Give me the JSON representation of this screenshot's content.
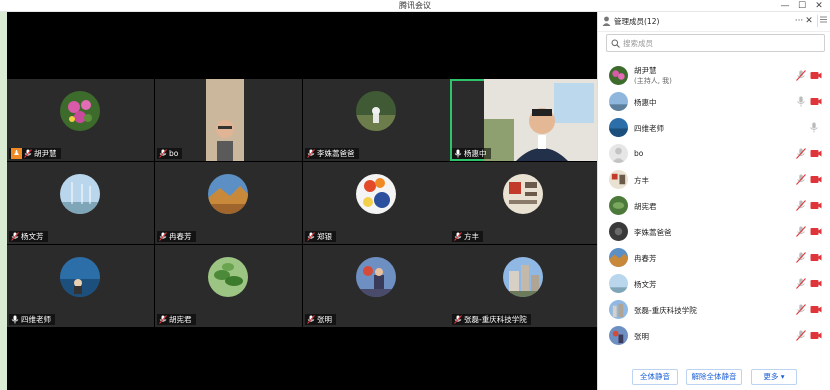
{
  "window": {
    "title": "腾讯会议",
    "minimize": "—",
    "maximize": "☐",
    "close": "✕"
  },
  "grid": {
    "tiles": [
      {
        "name": "胡尹慧",
        "host": true,
        "mic": "muted"
      },
      {
        "name": "bo",
        "mic": "muted"
      },
      {
        "name": "李姝蒿爸爸",
        "mic": "muted"
      },
      {
        "name": "杨惠中",
        "mic": "on",
        "active": true
      },
      {
        "name": "杨文芳",
        "mic": "muted"
      },
      {
        "name": "冉春芳",
        "mic": "muted"
      },
      {
        "name": "郑银",
        "mic": "muted"
      },
      {
        "name": "方丰",
        "mic": "muted"
      },
      {
        "name": "四维老师",
        "mic": "on"
      },
      {
        "name": "胡宪君",
        "mic": "muted"
      },
      {
        "name": "张明",
        "mic": "muted"
      },
      {
        "name": "张磊-重庆科技学院",
        "mic": "muted"
      }
    ]
  },
  "panel": {
    "title": "管理成员(12)",
    "more": "···",
    "close": "✕",
    "search_placeholder": "搜索成员",
    "members": [
      {
        "name": "胡尹慧",
        "sub": "(主持人, 我)",
        "mic": "muted",
        "video": "on"
      },
      {
        "name": "杨惠中",
        "mic": "on",
        "video": "on"
      },
      {
        "name": "四维老师",
        "mic": "on",
        "video": "none"
      },
      {
        "name": "bo",
        "mic": "muted",
        "video": "on"
      },
      {
        "name": "方丰",
        "mic": "muted",
        "video": "on"
      },
      {
        "name": "胡宪君",
        "mic": "muted",
        "video": "on"
      },
      {
        "name": "李姝蒿爸爸",
        "mic": "muted",
        "video": "on"
      },
      {
        "name": "冉春芳",
        "mic": "muted",
        "video": "on"
      },
      {
        "name": "杨文芳",
        "mic": "muted",
        "video": "on"
      },
      {
        "name": "张磊-重庆科技学院",
        "mic": "muted",
        "video": "on"
      },
      {
        "name": "张明",
        "mic": "muted",
        "video": "on"
      }
    ],
    "buttons": {
      "mute_all": "全体静音",
      "unmute_all": "解除全体静音",
      "more": "更多 ▾"
    }
  },
  "colors": {
    "active_border": "#2fc36b",
    "host_badge": "#f08a24",
    "muted_red": "#e0343b",
    "accent_blue": "#1a5fd6"
  }
}
